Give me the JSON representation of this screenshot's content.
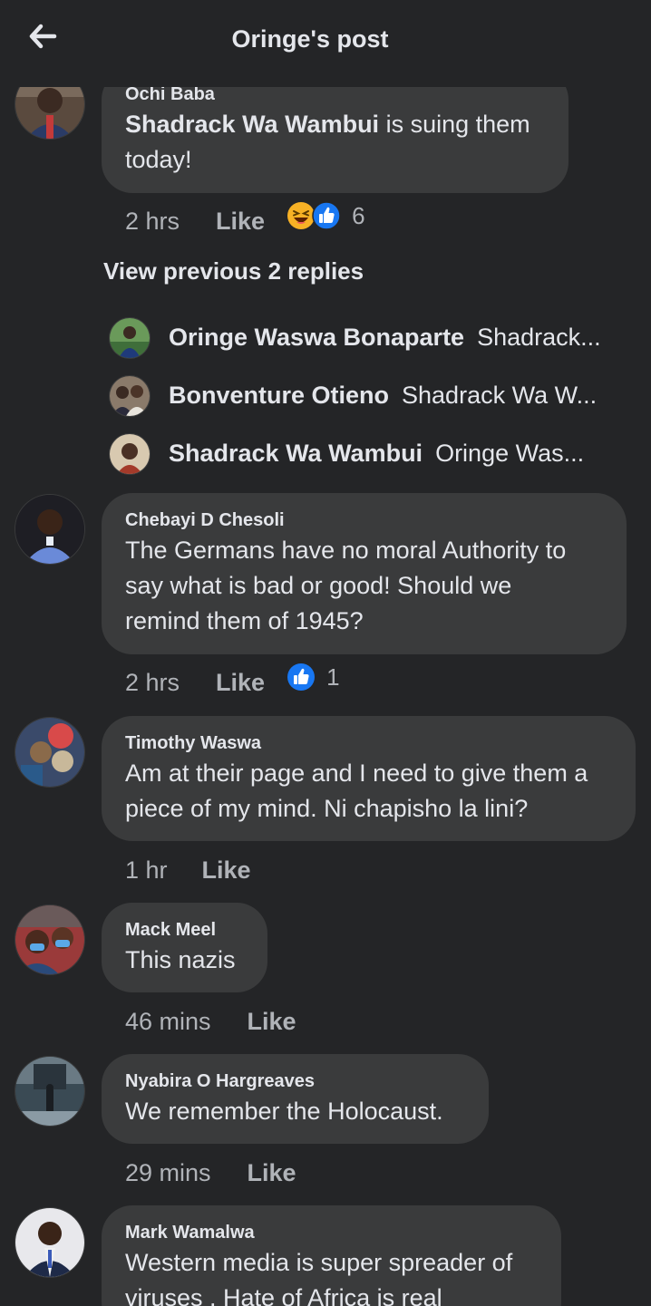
{
  "header": {
    "title": "Oringe's post"
  },
  "comments": [
    {
      "author": "Ochi Baba",
      "mention": "Shadrack Wa Wambui",
      "text_line1_rest": " is suing them",
      "text_line2": "today!",
      "time": "2 hrs",
      "like_label": "Like",
      "reaction_count": "6"
    },
    {
      "author": "Chebayi D Chesoli",
      "line1": "The Germans have no moral Authority  to",
      "line2": "say what is  bad or good! Should we",
      "line3": "remind them of 1945?",
      "time": "2 hrs",
      "like_label": "Like",
      "reaction_count": "1"
    },
    {
      "author": "Timothy Waswa",
      "line1": "Am at their page and I need to give them a",
      "line2": "piece of my mind. Ni chapisho la lini?",
      "time": "1 hr",
      "like_label": "Like"
    },
    {
      "author": "Mack Meel",
      "line1": "This nazis",
      "time": "46 mins",
      "like_label": "Like"
    },
    {
      "author": "Nyabira O Hargreaves",
      "line1": "We remember the Holocaust.",
      "time": "29 mins",
      "like_label": "Like"
    },
    {
      "author": "Mark Wamalwa",
      "line1": "Western media is super spreader of",
      "line2": "viruses . Hate of Africa is real"
    }
  ],
  "view_previous": "View previous 2 replies",
  "replies": [
    {
      "name": "Oringe Waswa Bonaparte",
      "snippet": "Shadrack..."
    },
    {
      "name": "Bonventure Otieno",
      "snippet": "Shadrack Wa W..."
    },
    {
      "name": "Shadrack Wa Wambui",
      "snippet": "Oringe Was..."
    }
  ],
  "icons": {
    "back": "arrow-left-icon",
    "haha": "haha-reaction-icon",
    "like": "like-reaction-icon"
  },
  "colors": {
    "background": "#242527",
    "bubble": "#3a3b3c",
    "text": "#e4e6eb",
    "meta": "#b0b3b8",
    "like_blue": "#1877f2",
    "haha_yellow": "#f7b125"
  }
}
